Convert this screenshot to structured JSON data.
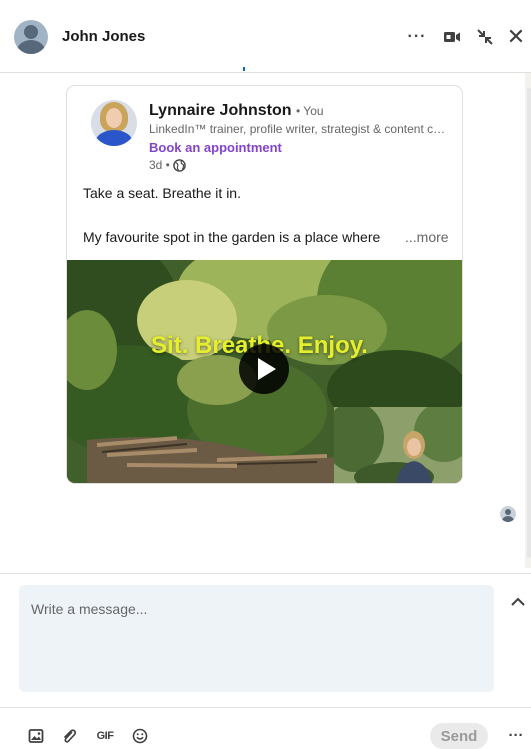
{
  "header": {
    "contact_name": "John Jones",
    "more_icon": "ellipsis-icon",
    "video_icon": "video-call-icon",
    "minimize_icon": "collapse-arrows-icon",
    "close_icon": "close-icon"
  },
  "post": {
    "author": "Lynnaire Johnston",
    "author_suffix": "• You",
    "headline": "LinkedIn™ trainer, profile writer, strategist & content creator",
    "cta": "Book an appointment",
    "time": "3d •",
    "visibility_icon": "globe-icon",
    "text_line1": "Take a seat. Breathe it in.",
    "text_line2": "My favourite spot in the garden is a place where",
    "see_more": "...more",
    "video": {
      "caption": "Sit. Breathe. Enjoy.",
      "play_icon": "play-icon"
    }
  },
  "compose": {
    "placeholder": "Write a message...",
    "expand_icon": "chevron-up-icon"
  },
  "footer": {
    "image_icon": "image-icon",
    "attach_icon": "paperclip-icon",
    "gif_label": "GIF",
    "emoji_icon": "emoji-icon",
    "send_label": "Send",
    "more_icon": "ellipsis-icon"
  },
  "colors": {
    "link_purple": "#8344cc",
    "compose_bg": "#eef3f8",
    "caption_yellow": "#e6ef2c"
  }
}
